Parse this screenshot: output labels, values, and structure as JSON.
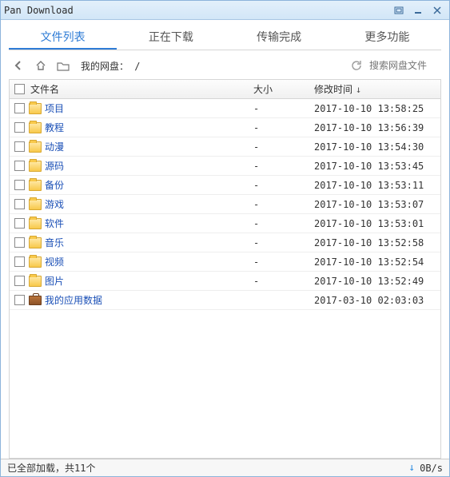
{
  "window": {
    "title": "Pan Download"
  },
  "tabs": [
    {
      "label": "文件列表",
      "active": true
    },
    {
      "label": "正在下载",
      "active": false
    },
    {
      "label": "传输完成",
      "active": false
    },
    {
      "label": "更多功能",
      "active": false
    }
  ],
  "toolbar": {
    "path_label": "我的网盘： /",
    "search_placeholder": "搜索网盘文件"
  },
  "columns": {
    "name": "文件名",
    "size": "大小",
    "mtime": "修改时间"
  },
  "sort": {
    "column": "mtime",
    "direction": "desc",
    "arrow": "↓"
  },
  "rows": [
    {
      "icon": "folder",
      "name": "项目",
      "size": "-",
      "mtime": "2017-10-10 13:58:25"
    },
    {
      "icon": "folder",
      "name": "教程",
      "size": "-",
      "mtime": "2017-10-10 13:56:39"
    },
    {
      "icon": "folder",
      "name": "动漫",
      "size": "-",
      "mtime": "2017-10-10 13:54:30"
    },
    {
      "icon": "folder",
      "name": "源码",
      "size": "-",
      "mtime": "2017-10-10 13:53:45"
    },
    {
      "icon": "folder",
      "name": "备份",
      "size": "-",
      "mtime": "2017-10-10 13:53:11"
    },
    {
      "icon": "folder",
      "name": "游戏",
      "size": "-",
      "mtime": "2017-10-10 13:53:07"
    },
    {
      "icon": "folder",
      "name": "软件",
      "size": "-",
      "mtime": "2017-10-10 13:53:01"
    },
    {
      "icon": "folder",
      "name": "音乐",
      "size": "-",
      "mtime": "2017-10-10 13:52:58"
    },
    {
      "icon": "folder",
      "name": "视频",
      "size": "-",
      "mtime": "2017-10-10 13:52:54"
    },
    {
      "icon": "folder",
      "name": "图片",
      "size": "-",
      "mtime": "2017-10-10 13:52:49"
    },
    {
      "icon": "briefcase",
      "name": "我的应用数据",
      "size": "",
      "mtime": "2017-03-10 02:03:03"
    }
  ],
  "statusbar": {
    "status": "已全部加载，共11个",
    "speed": "0B/s"
  }
}
